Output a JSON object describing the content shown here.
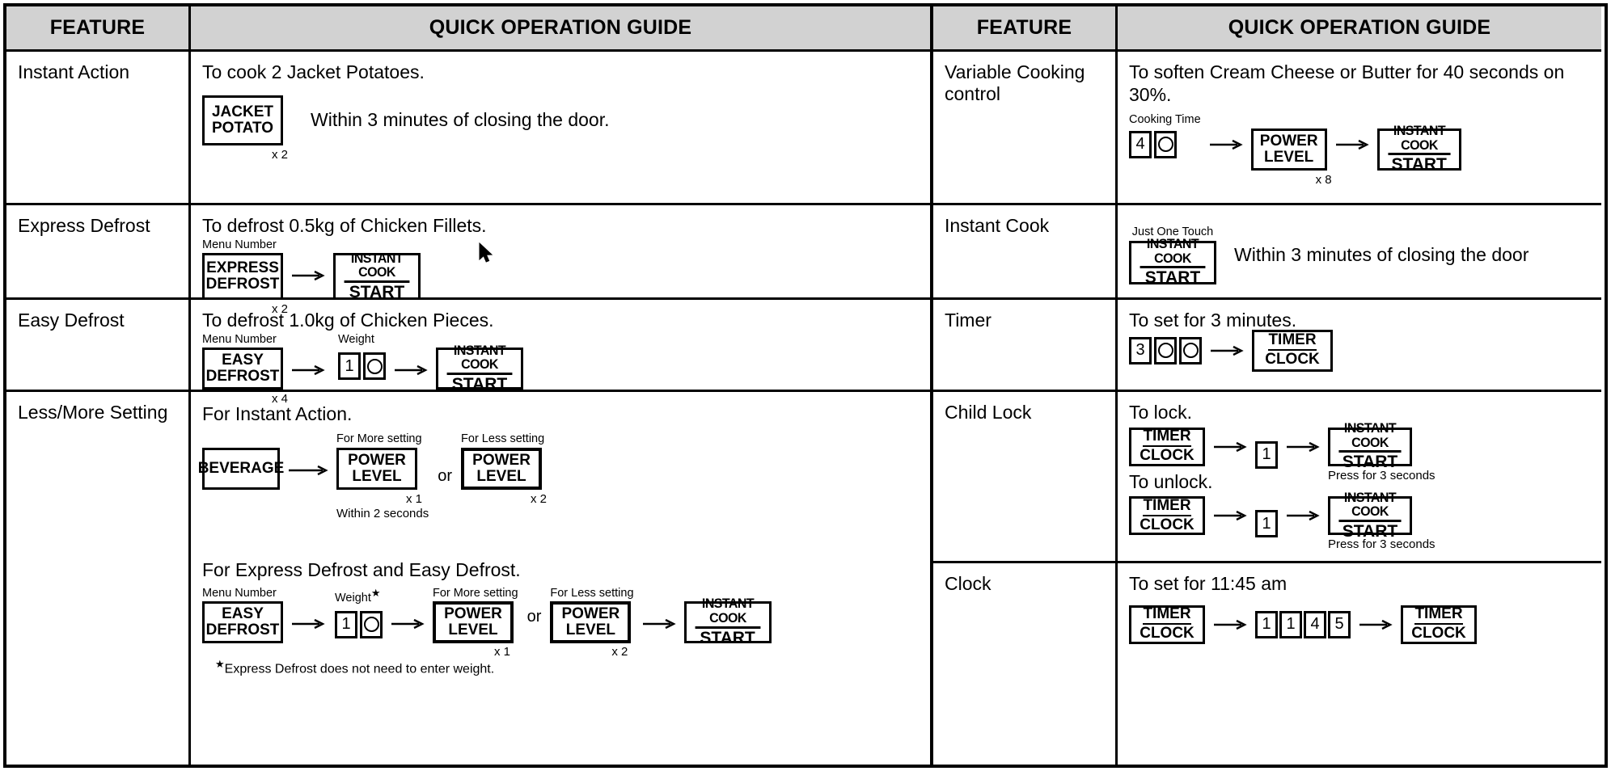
{
  "headers": {
    "feature": "FEATURE",
    "guide": "QUICK OPERATION GUIDE"
  },
  "keys": {
    "jacket_potato": {
      "l1": "JACKET",
      "l2": "POTATO"
    },
    "express_defrost": {
      "l1": "EXPRESS",
      "l2": "DEFROST"
    },
    "easy_defrost": {
      "l1": "EASY",
      "l2": "DEFROST"
    },
    "instant_cook_start": {
      "l1": "INSTANT COOK",
      "l2": "START"
    },
    "power_level": {
      "l1": "POWER",
      "l2": "LEVEL"
    },
    "timer_clock": {
      "l1": "TIMER",
      "l2": "CLOCK"
    },
    "beverage": {
      "l1": "BEVERAGE"
    }
  },
  "labels": {
    "menu_number": "Menu Number",
    "weight": "Weight",
    "weight_star": "Weight",
    "cooking_time": "Cooking Time",
    "just_one_touch": "Just One Touch",
    "for_more": "For More setting",
    "for_less": "For Less setting",
    "or": "or",
    "within_2_seconds": "Within 2 seconds",
    "press_for_3_seconds": "Press for 3 seconds"
  },
  "mult": {
    "x1": "x 1",
    "x2": "x 2",
    "x4": "x 4",
    "x8": "x 8"
  },
  "left_rows": [
    {
      "feature": "Instant Action",
      "lead": "To cook 2 Jacket Potatoes.",
      "side_text": "Within 3 minutes of closing the door.",
      "press_count": "x 2"
    },
    {
      "feature": "Express Defrost",
      "lead": "To defrost 0.5kg of Chicken Fillets.",
      "press_count": "x 2"
    },
    {
      "feature": "Easy Defrost",
      "lead": "To defrost 1.0kg of Chicken Pieces.",
      "press_count": "x 4",
      "weight_digits": [
        "1",
        "O"
      ]
    },
    {
      "feature": "Less/More Setting",
      "subhead_1": "For Instant Action.",
      "subhead_2": "For Express Defrost and Easy Defrost.",
      "footnote": "Express Defrost does not need to enter weight.",
      "weight_digits": [
        "1",
        "O"
      ]
    }
  ],
  "right_rows": [
    {
      "feature": "Variable Cooking control",
      "lead": "To soften Cream Cheese or Butter for 40 seconds on 30%.",
      "time_digits": [
        "4",
        "O"
      ],
      "press_count": "x 8"
    },
    {
      "feature": "Instant Cook",
      "side_text": "Within 3 minutes of closing the door"
    },
    {
      "feature": "Timer",
      "lead": "To set for 3 minutes.",
      "time_digits": [
        "3",
        "O",
        "O"
      ]
    },
    {
      "feature": "Child Lock",
      "lead_lock": "To lock.",
      "lead_unlock": "To unlock.",
      "digit_lock": "1",
      "digit_unlock": "1"
    },
    {
      "feature": "Clock",
      "lead": "To set for 11:45 am",
      "time_digits": [
        "1",
        "1",
        "4",
        "5"
      ]
    }
  ],
  "colors": {
    "header_bg": "#d2d2d2",
    "ink": "#000000",
    "page_bg": "#ffffff"
  }
}
